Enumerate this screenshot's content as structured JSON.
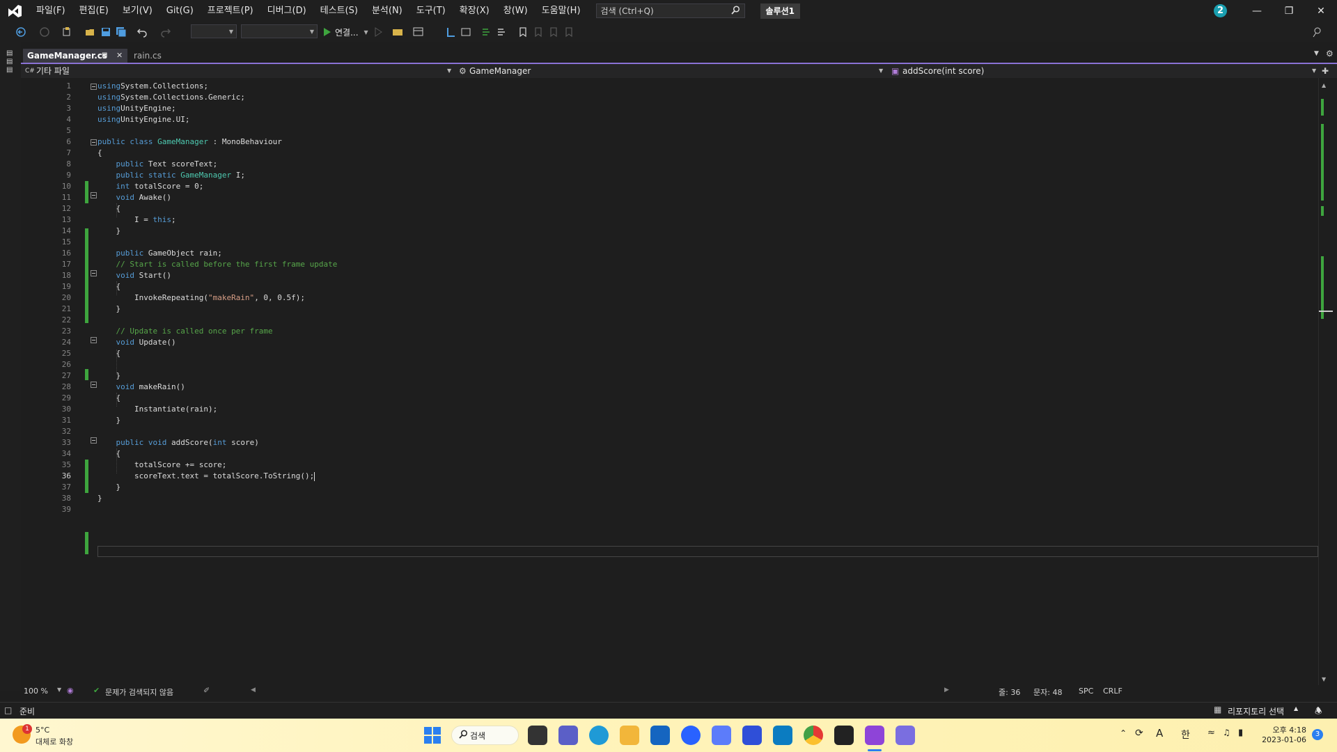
{
  "menu": {
    "items": [
      "파일(F)",
      "편집(E)",
      "보기(V)",
      "Git(G)",
      "프로젝트(P)",
      "디버그(D)",
      "테스트(S)",
      "분석(N)",
      "도구(T)",
      "확장(X)",
      "창(W)",
      "도움말(H)"
    ],
    "search_placeholder": "검색 (Ctrl+Q)",
    "solution_label": "솔루션1",
    "notification_count": "2"
  },
  "toolbar": {
    "run_label": "연결..."
  },
  "tabs": {
    "active": "GameManager.cs",
    "active_pin": "⊷",
    "other": "rain.cs"
  },
  "navbar": {
    "scope": "기타 파일",
    "class": "GameManager",
    "member": "addScore(int score)"
  },
  "editor": {
    "line_numbers": [
      "1",
      "2",
      "3",
      "4",
      "5",
      "6",
      "7",
      "8",
      "9",
      "10",
      "11",
      "12",
      "13",
      "14",
      "15",
      "16",
      "17",
      "18",
      "19",
      "20",
      "21",
      "22",
      "23",
      "24",
      "25",
      "26",
      "27",
      "28",
      "29",
      "30",
      "31",
      "32",
      "33",
      "34",
      "35",
      "36",
      "37",
      "38",
      "39"
    ],
    "current_line": 36,
    "code": [
      [
        [
          "kw",
          "using"
        ],
        [
          "",
          "System.Collections;"
        ]
      ],
      [
        [
          "kw",
          "using"
        ],
        [
          "",
          "System.Collections.Generic;"
        ]
      ],
      [
        [
          "kw",
          "using"
        ],
        [
          "",
          "UnityEngine;"
        ]
      ],
      [
        [
          "kw",
          "using"
        ],
        [
          "",
          "UnityEngine.UI;"
        ]
      ],
      [],
      [
        [
          "kw",
          "public class"
        ],
        [
          "",
          " "
        ],
        [
          "ty",
          "GameManager"
        ],
        [
          "",
          " : MonoBehaviour"
        ]
      ],
      [
        [
          "",
          "{"
        ]
      ],
      [
        [
          "",
          "    "
        ],
        [
          "kw",
          "public"
        ],
        [
          "",
          " Text scoreText;"
        ]
      ],
      [
        [
          "",
          "    "
        ],
        [
          "kw",
          "public static"
        ],
        [
          "",
          " "
        ],
        [
          "ty",
          "GameManager"
        ],
        [
          "",
          " I;"
        ]
      ],
      [
        [
          "",
          "    "
        ],
        [
          "kw",
          "int"
        ],
        [
          "",
          " totalScore = 0;"
        ]
      ],
      [
        [
          "",
          "    "
        ],
        [
          "kw",
          "void"
        ],
        [
          "",
          " Awake()"
        ]
      ],
      [
        [
          "",
          "    {"
        ]
      ],
      [
        [
          "",
          "        I = "
        ],
        [
          "kw",
          "this"
        ],
        [
          "",
          ";"
        ]
      ],
      [
        [
          "",
          "    }"
        ]
      ],
      [],
      [
        [
          "",
          "    "
        ],
        [
          "kw",
          "public"
        ],
        [
          "",
          " GameObject rain;"
        ]
      ],
      [
        [
          "",
          "    "
        ],
        [
          "cm",
          "// Start is called before the first frame update"
        ]
      ],
      [
        [
          "",
          "    "
        ],
        [
          "kw",
          "void"
        ],
        [
          "",
          " Start()"
        ]
      ],
      [
        [
          "",
          "    {"
        ]
      ],
      [
        [
          "",
          "        InvokeRepeating("
        ],
        [
          "st",
          "\"makeRain\""
        ],
        [
          "",
          ", 0, 0.5f);"
        ]
      ],
      [
        [
          "",
          "    }"
        ]
      ],
      [],
      [
        [
          "",
          "    "
        ],
        [
          "cm",
          "// Update is called once per frame"
        ]
      ],
      [
        [
          "",
          "    "
        ],
        [
          "kw",
          "void"
        ],
        [
          "",
          " Update()"
        ]
      ],
      [
        [
          "",
          "    {"
        ]
      ],
      [],
      [
        [
          "",
          "    }"
        ]
      ],
      [
        [
          "",
          "    "
        ],
        [
          "kw",
          "void"
        ],
        [
          "",
          " makeRain()"
        ]
      ],
      [
        [
          "",
          "    {"
        ]
      ],
      [
        [
          "",
          "        Instantiate(rain);"
        ]
      ],
      [
        [
          "",
          "    }"
        ]
      ],
      [],
      [
        [
          "",
          "    "
        ],
        [
          "kw",
          "public void"
        ],
        [
          "",
          " addScore("
        ],
        [
          "kw",
          "int"
        ],
        [
          "",
          " score)"
        ]
      ],
      [
        [
          "",
          "    {"
        ]
      ],
      [
        [
          "",
          "        totalScore += score;"
        ]
      ],
      [
        [
          "",
          "        scoreText.text = totalScore.ToString();"
        ]
      ],
      [
        [
          "",
          "    }"
        ]
      ],
      [
        [
          "",
          "}"
        ]
      ],
      []
    ]
  },
  "editor_status": {
    "zoom": "100 %",
    "issues": "문제가 검색되지 않음",
    "line": "줄: 36",
    "col": "문자: 48",
    "spacing": "SPC",
    "eol": "CRLF"
  },
  "statusbar": {
    "ready": "준비",
    "repo": "리포지토리 선택"
  },
  "taskbar": {
    "weather_temp": "5°C",
    "weather_desc": "대체로 화창",
    "weather_badge": "1",
    "search_label": "검색",
    "time": "오후 4:18",
    "date": "2023-01-06",
    "ime_hangul": "한",
    "ime_a": "A",
    "notif_count": "3"
  },
  "colors": {
    "accent": "#8a72d6",
    "change_bar": "#3ea53e",
    "keyword": "#569cd6",
    "type": "#4ec9b0",
    "comment": "#57a64a",
    "string": "#d69d85"
  }
}
